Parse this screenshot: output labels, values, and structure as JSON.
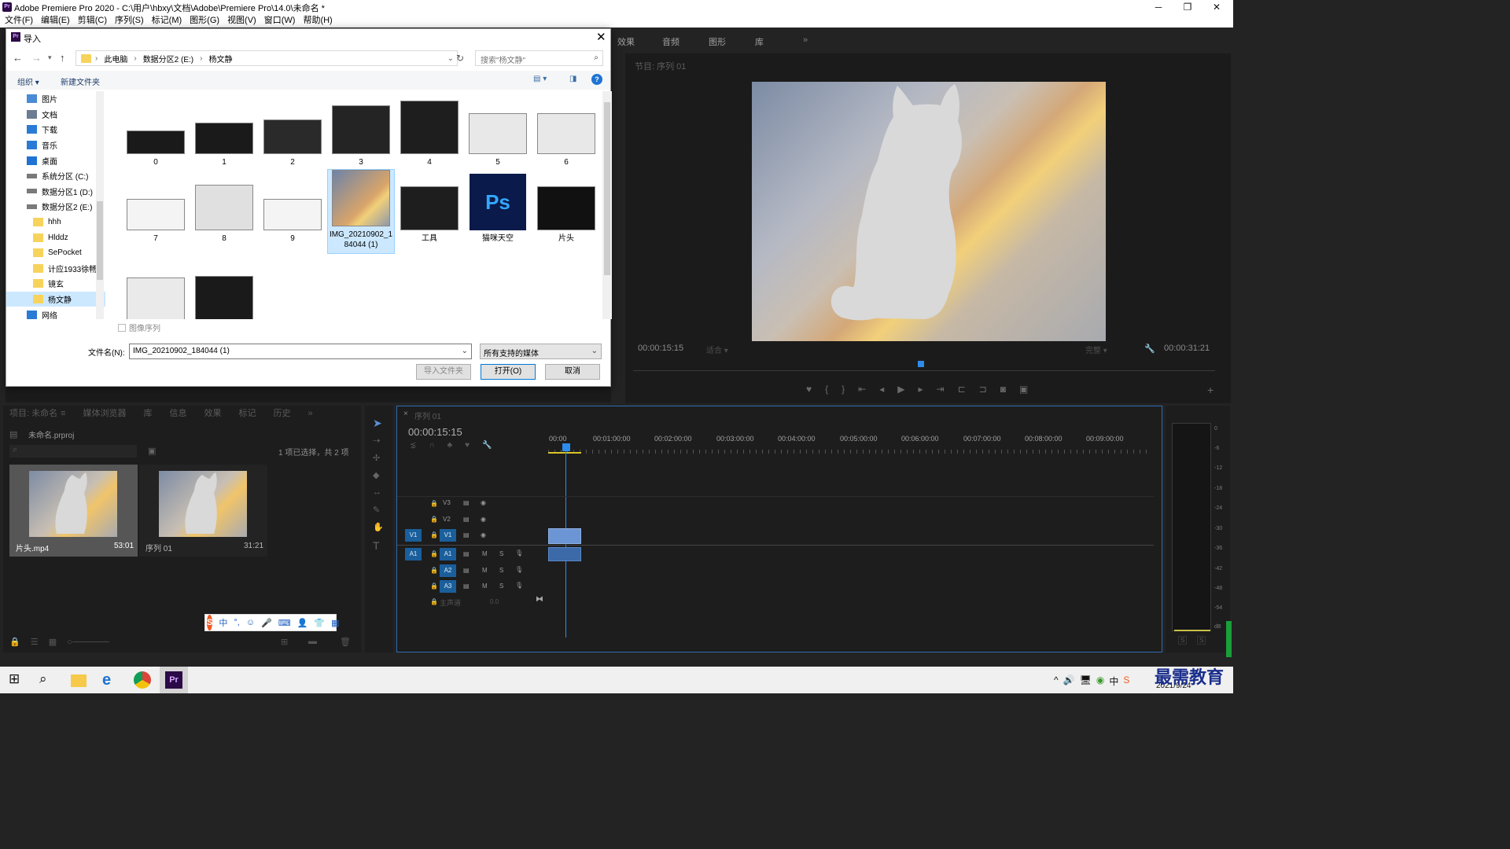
{
  "app": {
    "title": "Adobe Premiere Pro 2020 - C:\\用户\\hbxy\\文档\\Adobe\\Premiere Pro\\14.0\\未命名 *",
    "icon_label": "Pr"
  },
  "menu": [
    "文件(F)",
    "编辑(E)",
    "剪辑(C)",
    "序列(S)",
    "标记(M)",
    "图形(G)",
    "视图(V)",
    "窗口(W)",
    "帮助(H)"
  ],
  "workspace_tabs": [
    "效果",
    "音频",
    "图形",
    "库",
    "»"
  ],
  "program_monitor": {
    "tab": "节目: 序列 01",
    "timecode_left": "00:00:15:15",
    "fit": "适合",
    "quality": "完整",
    "timecode_right": "00:00:31:21"
  },
  "dialog": {
    "title": "导入",
    "breadcrumb": [
      "此电脑",
      "数据分区2 (E:)",
      "杨文静"
    ],
    "search_placeholder": "搜索\"杨文静\"",
    "organize": "组织 ▾",
    "new_folder": "新建文件夹",
    "nav_items": [
      {
        "label": "图片",
        "icon": "picture-icon"
      },
      {
        "label": "文档",
        "icon": "document-icon"
      },
      {
        "label": "下载",
        "icon": "download-icon"
      },
      {
        "label": "音乐",
        "icon": "music-icon"
      },
      {
        "label": "桌面",
        "icon": "desktop-icon"
      },
      {
        "label": "系统分区 (C:)",
        "icon": "drive-icon"
      },
      {
        "label": "数据分区1 (D:)",
        "icon": "drive-icon"
      },
      {
        "label": "数据分区2 (E:)",
        "icon": "drive-icon"
      },
      {
        "label": "hhh",
        "icon": "folder-icon"
      },
      {
        "label": "Hlddz",
        "icon": "folder-icon"
      },
      {
        "label": "SePocket",
        "icon": "folder-icon"
      },
      {
        "label": "计应1933徐畅",
        "icon": "folder-icon"
      },
      {
        "label": "镜玄",
        "icon": "folder-icon"
      },
      {
        "label": "杨文静",
        "icon": "folder-icon"
      },
      {
        "label": "网络",
        "icon": "network-icon"
      }
    ],
    "files": [
      "0",
      "1",
      "2",
      "3",
      "4",
      "5",
      "6",
      "7",
      "8",
      "9",
      "IMG_20210902_184044 (1)",
      "工具",
      "猫咪天空",
      "片头"
    ],
    "image_sequence_label": "图像序列",
    "filename_label": "文件名(N):",
    "filename_value": "IMG_20210902_184044 (1)",
    "filetype": "所有支持的媒体",
    "import_folder": "导入文件夹",
    "open": "打开(O)",
    "cancel": "取消"
  },
  "project": {
    "tabs": [
      "项目: 未命名",
      "≡",
      "媒体浏览器",
      "库",
      "信息",
      "效果",
      "标记",
      "历史",
      "»"
    ],
    "name": "未命名.prproj",
    "selection": "1 项已选择，共 2 项",
    "items": [
      {
        "name": "片头.mp4",
        "duration": "53:01"
      },
      {
        "name": "序列 01",
        "duration": "31:21"
      }
    ]
  },
  "timeline": {
    "tab": "序列 01",
    "timecode": "00:00:15:15",
    "ruler": [
      "00:00",
      "00:01:00:00",
      "00:02:00:00",
      "00:03:00:00",
      "00:04:00:00",
      "00:05:00:00",
      "00:06:00:00",
      "00:07:00:00",
      "00:08:00:00",
      "00:09:00:00"
    ],
    "video_tracks": [
      "V3",
      "V2",
      "V1"
    ],
    "audio_tracks": [
      "A1",
      "A2",
      "A3"
    ],
    "source_v": "V1",
    "source_a": "A1",
    "master": "主声道",
    "master_value": "0.0"
  },
  "meter": {
    "scale": [
      "0",
      "-6",
      "-12",
      "-18",
      "-24",
      "-30",
      "-36",
      "-42",
      "-48",
      "-54",
      "dB"
    ],
    "solo": [
      "S",
      "S"
    ]
  },
  "ime": {
    "label": "中",
    "punct": "°,"
  },
  "taskbar": {
    "date": "2021/9/24",
    "watermark": "最需教育"
  }
}
